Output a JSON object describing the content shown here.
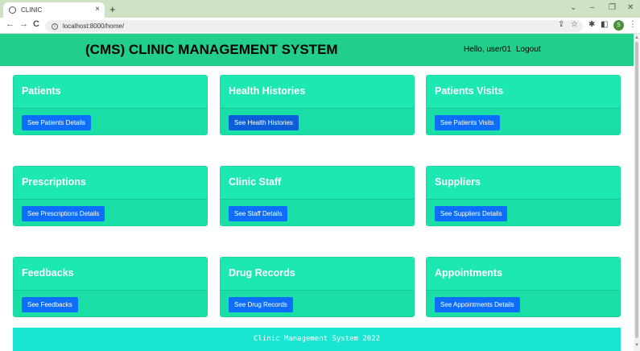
{
  "browser": {
    "tab_title": "CLINIC",
    "tab_close": "×",
    "new_tab": "+",
    "url": "localhost:8000/home/",
    "profile_initial": "S",
    "nav": {
      "back": "←",
      "forward": "→",
      "reload": "C"
    },
    "window_controls": {
      "collapse": "⌄",
      "minimize": "–",
      "restore": "❐",
      "close": "✕"
    },
    "omnibox_icons": {
      "share": "⇪",
      "star": "☆",
      "extensions": "✱",
      "sidepanel": "◧",
      "menu": "⋮"
    }
  },
  "navbar": {
    "brand": "(CMS) CLINIC MANAGEMENT SYSTEM",
    "greeting": "Hello, user01",
    "logout": "Logout"
  },
  "cards": [
    {
      "title": "Patients",
      "button": "See Patients Details"
    },
    {
      "title": "Health Histories",
      "button": "See Health Histories"
    },
    {
      "title": "Patients Visits",
      "button": "See Patients Visits"
    },
    {
      "title": "Prescriptions",
      "button": "See Prescriptions Details"
    },
    {
      "title": "Clinic Staff",
      "button": "See Staff Details"
    },
    {
      "title": "Suppliers",
      "button": "See Suppliers Details"
    },
    {
      "title": "Feedbacks",
      "button": "See Feedbacks"
    },
    {
      "title": "Drug Records",
      "button": "See Drug Records"
    },
    {
      "title": "Appointments",
      "button": "See Appointments Details"
    }
  ],
  "footer": "Clinic Management System 2022",
  "scrollbar": {
    "up": "▲",
    "down": "▼"
  },
  "colors": {
    "navbar": "#21cf8b",
    "card": "#1ee8b2",
    "button": "#0d6efd",
    "footer": "#19e6d2"
  }
}
